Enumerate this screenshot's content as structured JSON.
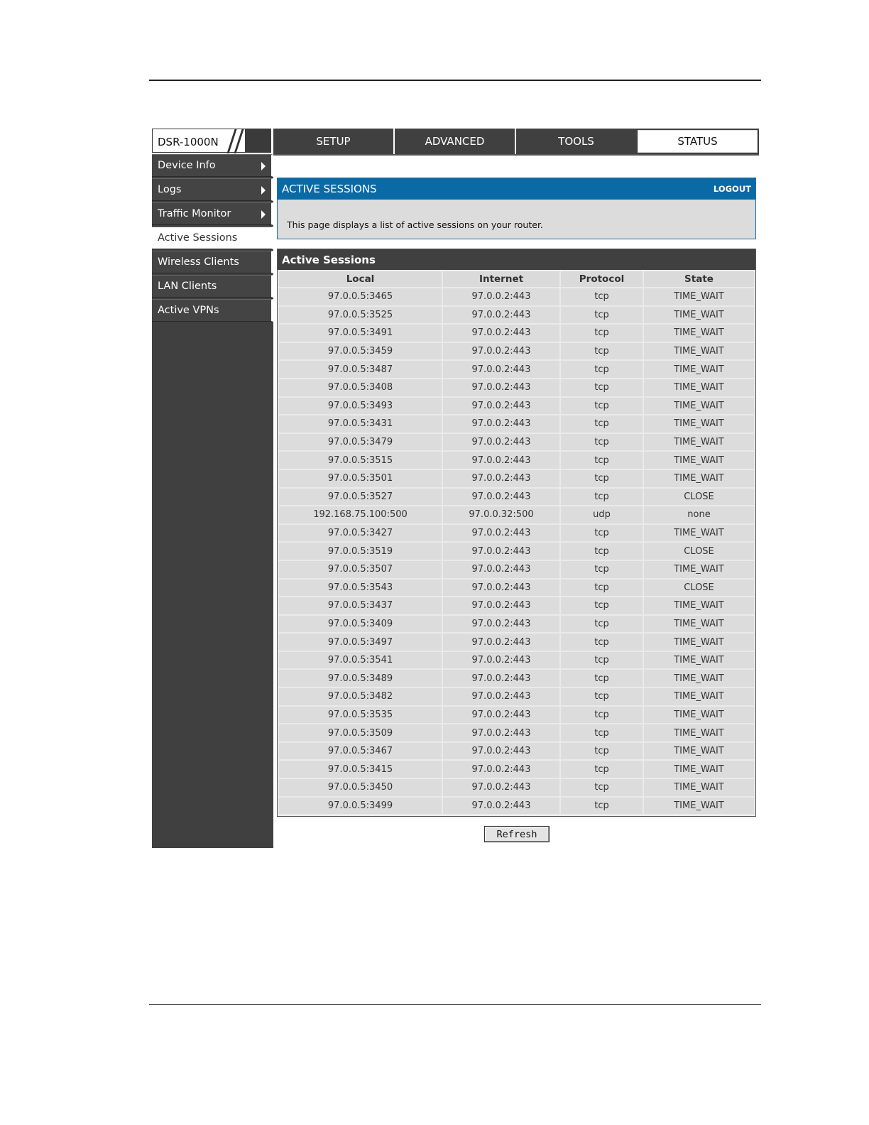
{
  "brand": {
    "model": "DSR-1000N"
  },
  "nav": {
    "tabs": [
      "SETUP",
      "ADVANCED",
      "TOOLS",
      "STATUS"
    ],
    "active": "STATUS"
  },
  "sidebar": {
    "items": [
      {
        "label": "Device Info",
        "has_arrow": true
      },
      {
        "label": "Logs",
        "has_arrow": true
      },
      {
        "label": "Traffic Monitor",
        "has_arrow": true
      },
      {
        "label": "Active Sessions",
        "has_arrow": false,
        "active": true
      },
      {
        "label": "Wireless Clients",
        "has_arrow": false
      },
      {
        "label": "LAN Clients",
        "has_arrow": false
      },
      {
        "label": "Active VPNs",
        "has_arrow": false
      }
    ]
  },
  "info": {
    "title": "ACTIVE SESSIONS",
    "logout": "LOGOUT",
    "description": "This page displays a list of active sessions on your router."
  },
  "sessions": {
    "title": "Active Sessions",
    "columns": [
      "Local",
      "Internet",
      "Protocol",
      "State"
    ],
    "rows": [
      [
        "97.0.0.5:3465",
        "97.0.0.2:443",
        "tcp",
        "TIME_WAIT"
      ],
      [
        "97.0.0.5:3525",
        "97.0.0.2:443",
        "tcp",
        "TIME_WAIT"
      ],
      [
        "97.0.0.5:3491",
        "97.0.0.2:443",
        "tcp",
        "TIME_WAIT"
      ],
      [
        "97.0.0.5:3459",
        "97.0.0.2:443",
        "tcp",
        "TIME_WAIT"
      ],
      [
        "97.0.0.5:3487",
        "97.0.0.2:443",
        "tcp",
        "TIME_WAIT"
      ],
      [
        "97.0.0.5:3408",
        "97.0.0.2:443",
        "tcp",
        "TIME_WAIT"
      ],
      [
        "97.0.0.5:3493",
        "97.0.0.2:443",
        "tcp",
        "TIME_WAIT"
      ],
      [
        "97.0.0.5:3431",
        "97.0.0.2:443",
        "tcp",
        "TIME_WAIT"
      ],
      [
        "97.0.0.5:3479",
        "97.0.0.2:443",
        "tcp",
        "TIME_WAIT"
      ],
      [
        "97.0.0.5:3515",
        "97.0.0.2:443",
        "tcp",
        "TIME_WAIT"
      ],
      [
        "97.0.0.5:3501",
        "97.0.0.2:443",
        "tcp",
        "TIME_WAIT"
      ],
      [
        "97.0.0.5:3527",
        "97.0.0.2:443",
        "tcp",
        "CLOSE"
      ],
      [
        "192.168.75.100:500",
        "97.0.0.32:500",
        "udp",
        "none"
      ],
      [
        "97.0.0.5:3427",
        "97.0.0.2:443",
        "tcp",
        "TIME_WAIT"
      ],
      [
        "97.0.0.5:3519",
        "97.0.0.2:443",
        "tcp",
        "CLOSE"
      ],
      [
        "97.0.0.5:3507",
        "97.0.0.2:443",
        "tcp",
        "TIME_WAIT"
      ],
      [
        "97.0.0.5:3543",
        "97.0.0.2:443",
        "tcp",
        "CLOSE"
      ],
      [
        "97.0.0.5:3437",
        "97.0.0.2:443",
        "tcp",
        "TIME_WAIT"
      ],
      [
        "97.0.0.5:3409",
        "97.0.0.2:443",
        "tcp",
        "TIME_WAIT"
      ],
      [
        "97.0.0.5:3497",
        "97.0.0.2:443",
        "tcp",
        "TIME_WAIT"
      ],
      [
        "97.0.0.5:3541",
        "97.0.0.2:443",
        "tcp",
        "TIME_WAIT"
      ],
      [
        "97.0.0.5:3489",
        "97.0.0.2:443",
        "tcp",
        "TIME_WAIT"
      ],
      [
        "97.0.0.5:3482",
        "97.0.0.2:443",
        "tcp",
        "TIME_WAIT"
      ],
      [
        "97.0.0.5:3535",
        "97.0.0.2:443",
        "tcp",
        "TIME_WAIT"
      ],
      [
        "97.0.0.5:3509",
        "97.0.0.2:443",
        "tcp",
        "TIME_WAIT"
      ],
      [
        "97.0.0.5:3467",
        "97.0.0.2:443",
        "tcp",
        "TIME_WAIT"
      ],
      [
        "97.0.0.5:3415",
        "97.0.0.2:443",
        "tcp",
        "TIME_WAIT"
      ],
      [
        "97.0.0.5:3450",
        "97.0.0.2:443",
        "tcp",
        "TIME_WAIT"
      ],
      [
        "97.0.0.5:3499",
        "97.0.0.2:443",
        "tcp",
        "TIME_WAIT"
      ]
    ]
  },
  "actions": {
    "refresh_label": "Refresh"
  }
}
